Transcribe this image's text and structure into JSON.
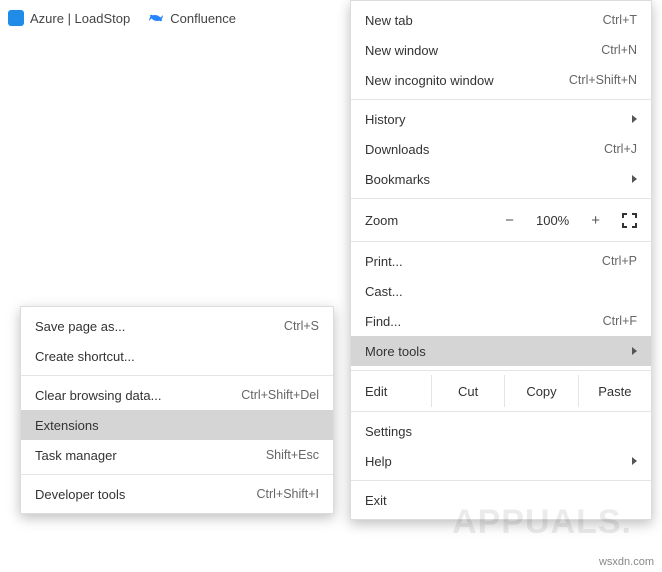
{
  "bookmarks": {
    "azure": "Azure | LoadStop",
    "confluence": "Confluence"
  },
  "menu": {
    "new_tab": {
      "label": "New tab",
      "shortcut": "Ctrl+T"
    },
    "new_window": {
      "label": "New window",
      "shortcut": "Ctrl+N"
    },
    "new_incognito": {
      "label": "New incognito window",
      "shortcut": "Ctrl+Shift+N"
    },
    "history": {
      "label": "History"
    },
    "downloads": {
      "label": "Downloads",
      "shortcut": "Ctrl+J"
    },
    "bookmarks": {
      "label": "Bookmarks"
    },
    "zoom": {
      "label": "Zoom",
      "minus": "−",
      "value": "100%",
      "plus": "+"
    },
    "print": {
      "label": "Print...",
      "shortcut": "Ctrl+P"
    },
    "cast": {
      "label": "Cast..."
    },
    "find": {
      "label": "Find...",
      "shortcut": "Ctrl+F"
    },
    "more_tools": {
      "label": "More tools"
    },
    "edit": {
      "label": "Edit",
      "cut": "Cut",
      "copy": "Copy",
      "paste": "Paste"
    },
    "settings": {
      "label": "Settings"
    },
    "help": {
      "label": "Help"
    },
    "exit": {
      "label": "Exit"
    }
  },
  "submenu": {
    "save_as": {
      "label": "Save page as...",
      "shortcut": "Ctrl+S"
    },
    "create_shortcut": {
      "label": "Create shortcut..."
    },
    "clear_data": {
      "label": "Clear browsing data...",
      "shortcut": "Ctrl+Shift+Del"
    },
    "extensions": {
      "label": "Extensions"
    },
    "task_manager": {
      "label": "Task manager",
      "shortcut": "Shift+Esc"
    },
    "dev_tools": {
      "label": "Developer tools",
      "shortcut": "Ctrl+Shift+I"
    }
  },
  "watermark": "APPUALS.",
  "footer": "wsxdn.com"
}
